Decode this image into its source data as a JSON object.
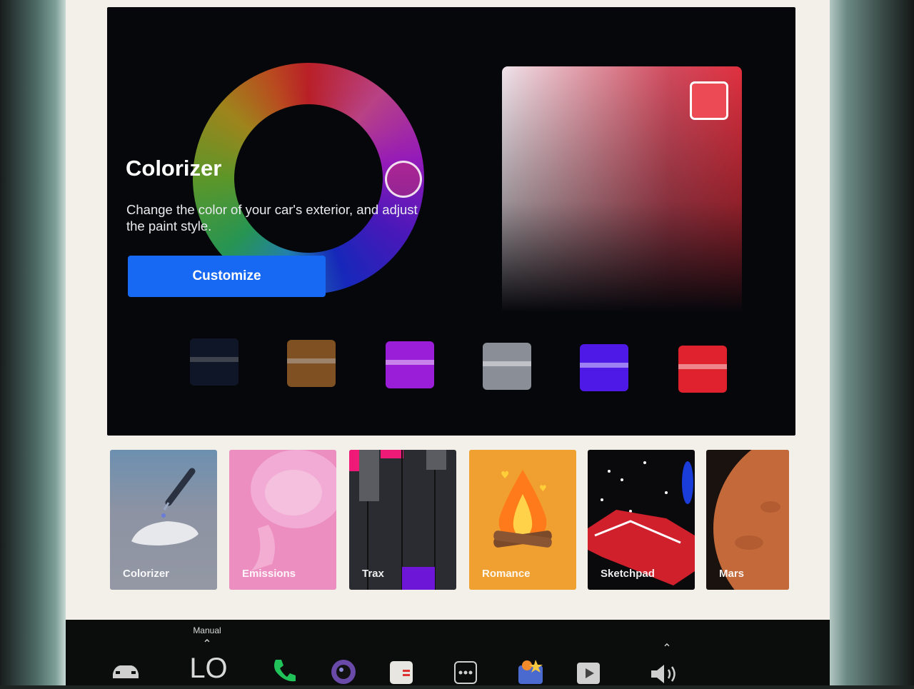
{
  "hero": {
    "title": "Colorizer",
    "description": "Change the color of your car's exterior, and adjust the paint style.",
    "customize_label": "Customize"
  },
  "picker": {
    "selected_color": "#ec4a55"
  },
  "paint_swatches": [
    {
      "name": "midnight-blue",
      "color": "#1b2a4a"
    },
    {
      "name": "bronze",
      "color": "#a8692a"
    },
    {
      "name": "violet",
      "color": "#9a1ed8"
    },
    {
      "name": "silver",
      "color": "#8a8f97"
    },
    {
      "name": "indigo",
      "color": "#4e18e6"
    },
    {
      "name": "red",
      "color": "#e0222e"
    }
  ],
  "apps": [
    {
      "label": "Colorizer",
      "color": "#8b92a3"
    },
    {
      "label": "Emissions",
      "color": "#ec8fc0"
    },
    {
      "label": "Trax",
      "color": "#2a2c31"
    },
    {
      "label": "Romance",
      "color": "#f0a030"
    },
    {
      "label": "Sketchpad",
      "color": "#0a0a0d"
    },
    {
      "label": "Mars",
      "color": "#c46a3a"
    }
  ],
  "taskbar": {
    "climate_mode": "Manual",
    "temperature": "LO",
    "icons": [
      "car-icon",
      "phone-icon",
      "camera-icon",
      "calendar-icon",
      "more-apps-icon",
      "toybox-icon",
      "media-icon",
      "volume-icon"
    ]
  }
}
